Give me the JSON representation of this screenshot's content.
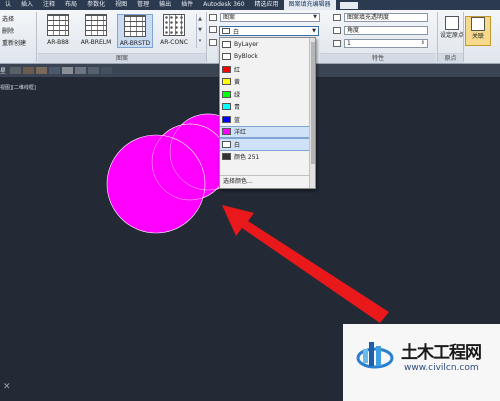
{
  "ribbon_tabs": [
    "认",
    "插入",
    "注释",
    "布局",
    "参数化",
    "视图",
    "管理",
    "输出",
    "插件",
    "Autodesk 360",
    "精选应用",
    "图案填充编辑器"
  ],
  "left_commands": [
    "选择",
    "删除",
    "重新创建"
  ],
  "pattern_swatches": [
    "AR-B88",
    "AR-BRELM",
    "AR-BRSTD",
    "AR-CONC"
  ],
  "panels": {
    "pattern": "图案",
    "properties": "特性",
    "origin": "原点"
  },
  "properties": {
    "pattern_type": "图案",
    "color_value": "白",
    "transparency_label": "图案填充透明度",
    "angle_label": "角度",
    "scale_value": "1"
  },
  "origin": {
    "set_origin": "设定原点",
    "associate": "关联"
  },
  "file_strip_label": "星",
  "viewport_label": "视图][二维线框]",
  "color_dropdown": {
    "items": [
      {
        "label": "ByLayer",
        "color": "#ffffff"
      },
      {
        "label": "ByBlock",
        "color": "#ffffff"
      },
      {
        "label": "红",
        "color": "#ff0000"
      },
      {
        "label": "黄",
        "color": "#ffff00"
      },
      {
        "label": "绿",
        "color": "#00ff00"
      },
      {
        "label": "青",
        "color": "#00ffff"
      },
      {
        "label": "蓝",
        "color": "#0000ff"
      },
      {
        "label": "洋红",
        "color": "#ff00ff"
      },
      {
        "label": "白",
        "color": "#ffffff"
      },
      {
        "label": "颜色 251",
        "color": "#333333"
      }
    ],
    "more_label": "选择颜色..."
  },
  "colors": {
    "hatch_fill": "#ff00ff",
    "arrow": "#e8181b",
    "canvas": "#232a36"
  },
  "watermark": {
    "title": "土木工程网",
    "url": "www.civilcn.com"
  }
}
